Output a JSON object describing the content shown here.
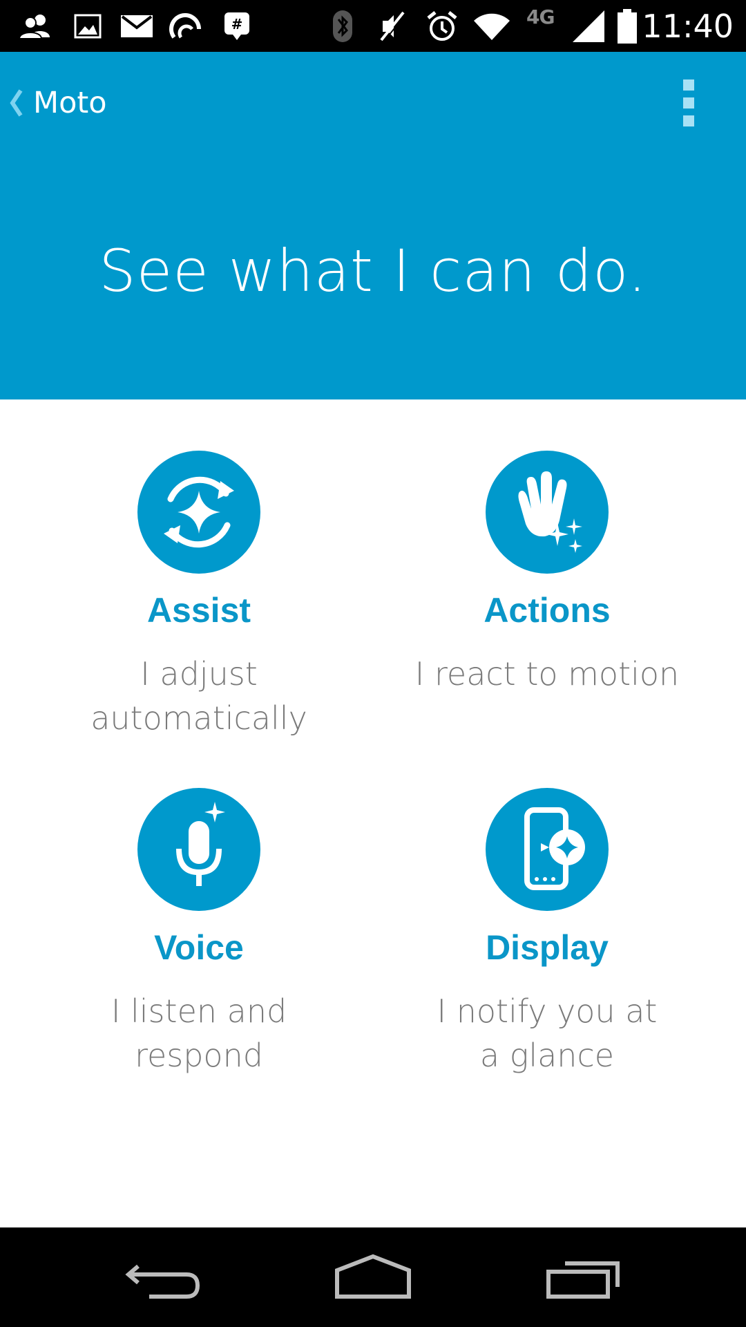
{
  "status_bar": {
    "left_icons": [
      "contacts-icon",
      "gallery-icon",
      "gmail-icon",
      "sync-icon",
      "bbm-icon"
    ],
    "right_icons": [
      "bluetooth-icon",
      "mute-icon",
      "alarm-icon",
      "wifi-icon",
      "signal-icon",
      "battery-icon"
    ],
    "network_label": "4G",
    "time": "11:40"
  },
  "header": {
    "back_label": "Moto",
    "hero_title": "See what I can do.",
    "background_color": "#0099cc"
  },
  "features": [
    {
      "title": "Assist",
      "description": "I adjust automatically",
      "icon": "assist-sync-sparkle-icon"
    },
    {
      "title": "Actions",
      "description": "I react to motion",
      "icon": "wave-hand-icon"
    },
    {
      "title": "Voice",
      "description": "I listen and respond",
      "icon": "microphone-icon"
    },
    {
      "title": "Display",
      "description": "I notify you at a glance",
      "icon": "phone-notification-icon"
    }
  ],
  "nav_bar": {
    "buttons": [
      "back-icon",
      "home-icon",
      "recents-icon"
    ]
  },
  "colors": {
    "accent": "#0099cc",
    "title_text": "#0a96c8",
    "description_text": "#7a7a7a"
  }
}
